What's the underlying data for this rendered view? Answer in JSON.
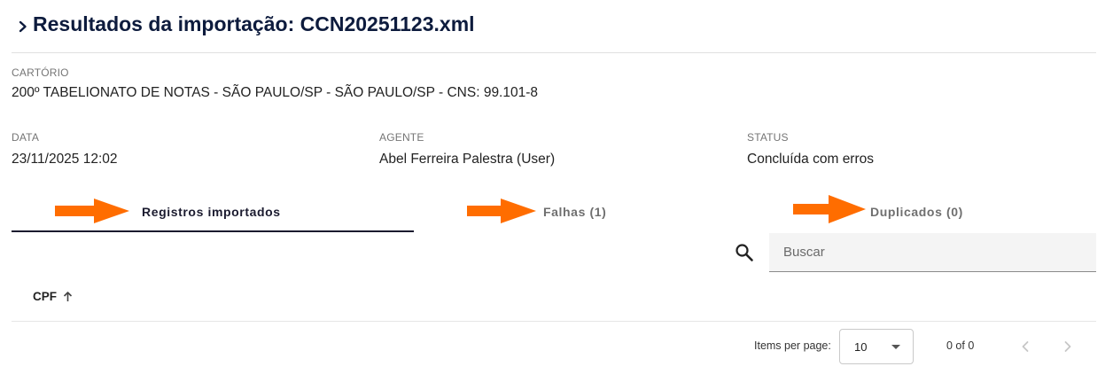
{
  "header": {
    "title": "Resultados da importação: CCN20251123.xml"
  },
  "cartorio": {
    "label": "CARTÓRIO",
    "value": "200º TABELIONATO DE NOTAS - SÃO PAULO/SP - SÃO PAULO/SP - CNS: 99.101-8"
  },
  "info": {
    "data_label": "DATA",
    "data_value": "23/11/2025 12:02",
    "agente_label": "AGENTE",
    "agente_value": "Abel Ferreira Palestra (User)",
    "status_label": "STATUS",
    "status_value": "Concluída com erros"
  },
  "tabs": [
    {
      "label": "Registros importados",
      "active": true
    },
    {
      "label": "Falhas (1)",
      "active": false
    },
    {
      "label": "Duplicados (0)",
      "active": false
    }
  ],
  "annotation_color": "#ff6d00",
  "search": {
    "placeholder": "Buscar",
    "value": ""
  },
  "table": {
    "columns": [
      {
        "label": "CPF",
        "sort": "ascending"
      }
    ]
  },
  "paginator": {
    "items_per_page_label": "Items per page:",
    "items_per_page_value": "10",
    "range_label": "0 of 0"
  },
  "colors": {
    "title": "#0d1b3d",
    "active_tab": "#1b1b2f",
    "inactive_tab": "#6f6f6f"
  }
}
